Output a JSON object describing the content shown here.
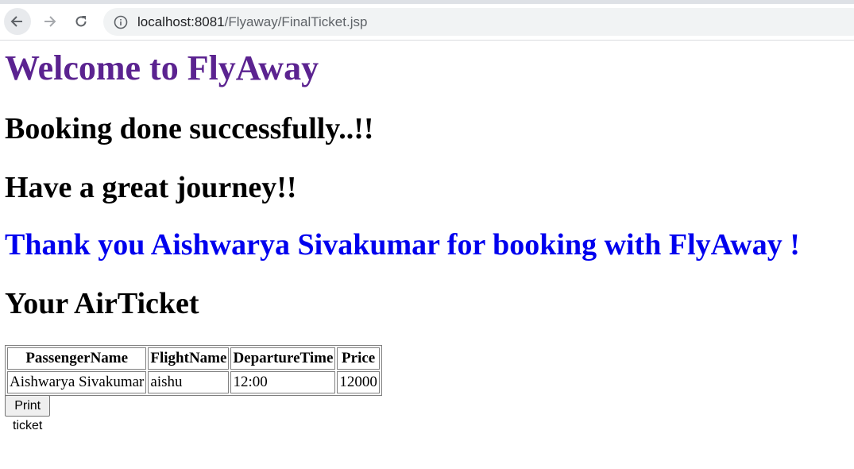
{
  "browser": {
    "url_host": "localhost:8081",
    "url_path": "/Flyaway/FinalTicket.jsp",
    "back_icon": "arrow-left-icon",
    "forward_icon": "arrow-right-icon",
    "reload_icon": "reload-icon",
    "info_icon": "info-icon"
  },
  "page": {
    "welcome": "Welcome to FlyAway",
    "booking_done": "Booking done successfully..!!",
    "journey": "Have a great journey!!",
    "thanks": "Thank you Aishwarya Sivakumar for booking with FlyAway !",
    "ticket_heading": "Your AirTicket",
    "print_button": "Print ticket"
  },
  "ticket": {
    "headers": [
      "PassengerName",
      "FlightName",
      "DepartureTime",
      "Price"
    ],
    "rows": [
      [
        "Aishwarya Sivakumar",
        "aishu",
        "12:00",
        "12000"
      ]
    ]
  },
  "colors": {
    "welcome": "#5b2390",
    "thanks": "#0000ee"
  }
}
